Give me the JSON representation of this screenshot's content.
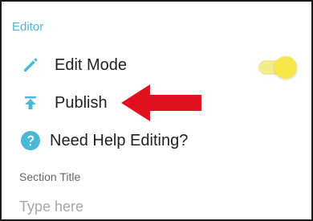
{
  "header": {
    "title": "Editor"
  },
  "menu": {
    "items": [
      {
        "label": "Edit Mode",
        "icon": "pencil-icon",
        "toggle_on": true
      },
      {
        "label": "Publish",
        "icon": "upload-icon"
      },
      {
        "label": "Need Help Editing?",
        "icon": "help-icon"
      }
    ]
  },
  "section": {
    "title_label": "Section Title",
    "title_placeholder": "Type here",
    "title_value": ""
  },
  "colors": {
    "accent": "#4bb8d7",
    "toggle_track": "#f2ea8e",
    "toggle_thumb": "#f7e748",
    "annotation_arrow": "#e0101f"
  }
}
